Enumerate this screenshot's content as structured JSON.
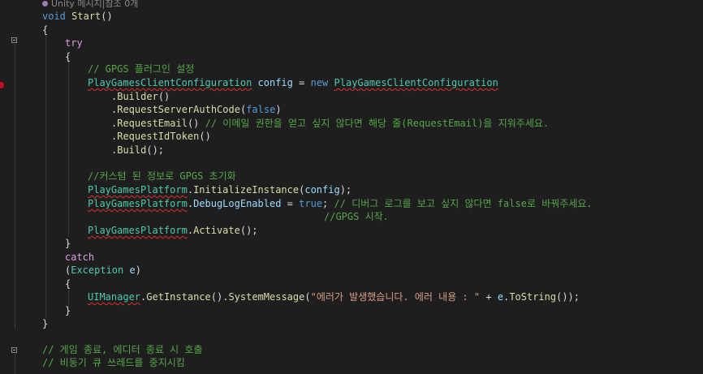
{
  "codelens": {
    "text": "Unity 메시지|참조 0개",
    "icon": "unity-message-icon"
  },
  "colors": {
    "background": "#1e1e1e",
    "keyword": "#569cd6",
    "control": "#d8a0df",
    "type": "#4ec9b0",
    "method": "#dcdcaa",
    "string": "#d69d85",
    "comment": "#57a64a",
    "breakpoint": "#c50f1f"
  },
  "code": {
    "void": "void",
    "start": "Start",
    "try": "try",
    "catch": "catch",
    "true": "true",
    "false": "false",
    "new": "new",
    "cmt_gpgs_setting": "// GPGS 플러그인 설정",
    "cmt_request_email": "// 이메일 권한을 얻고 싶지 않다면 해당 줄(RequestEmail)을 지워주세요.",
    "cmt_custom_init": "//커스텀 된 정보로 GPGS 초기화",
    "cmt_debug": "// 디버그 로그를 보고 싶지 않다면 false로 바꿔주세요.",
    "cmt_gpgs_start": "//GPGS 시작.",
    "cmt_game_exit": "// 게임 종료, 에디터 종료 시 호출",
    "cmt_stop_thread": "// 비동기 큐 쓰레드를 중지시킴",
    "type_config_class": "PlayGamesClientConfiguration",
    "type_platform": "PlayGamesPlatform",
    "type_exception": "Exception",
    "type_uimanager": "UIManager",
    "var_config": "config",
    "var_e": "e",
    "m_builder": "Builder",
    "m_auth": "RequestServerAuthCode",
    "m_email": "RequestEmail",
    "m_idtoken": "RequestIdToken",
    "m_build": "Build",
    "m_init": "InitializeInstance",
    "m_debuglog": "DebugLogEnabled",
    "m_activate": "Activate",
    "m_getinstance": "GetInstance",
    "m_sysmsg": "SystemMessage",
    "m_tostring": "ToString",
    "str_error": "\"에러가 발생했습니다. 에러 내용 : \""
  }
}
